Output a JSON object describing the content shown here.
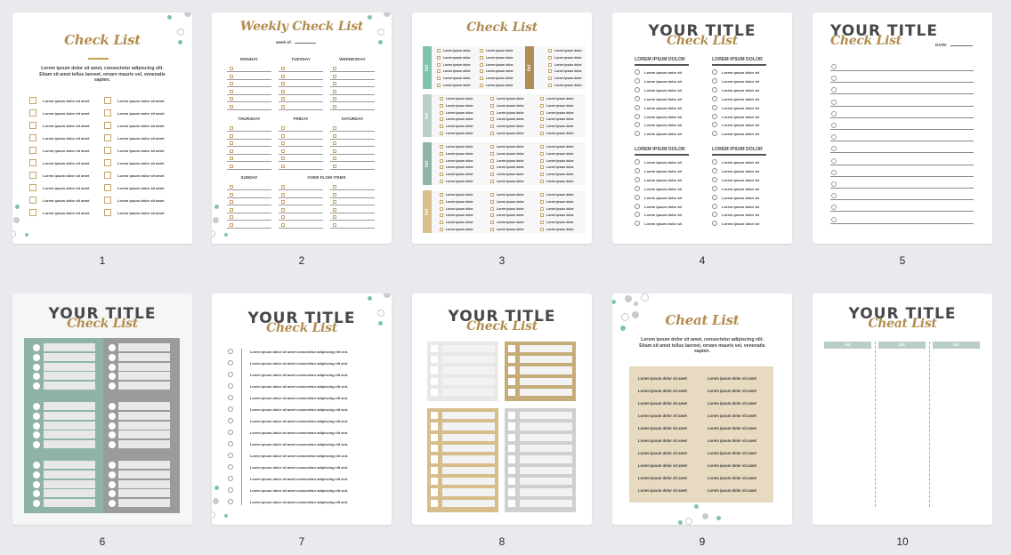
{
  "colors": {
    "background": "#e9eaee",
    "gold": "#b28d4f",
    "teal": "#7fc4ae",
    "sage": "#8fb3a7",
    "grey": "#9b9b9b",
    "tan": "#e8dac0",
    "charcoal": "#454749"
  },
  "pages": [
    {
      "number": "1",
      "title": "Check List",
      "intro": "Lorem ipsum dolor sit amet, consectetur adipiscing elit. Etiam sit amet tellus laoreet, ornare mauris vel, venenatis sapien.",
      "item": "Lorem ipsum dolor sit amet",
      "rows": 10,
      "columns": 2
    },
    {
      "number": "2",
      "title": "Weekly Check List",
      "week_label": "week of:",
      "days": [
        "MONDAY",
        "TUESDAY",
        "WEDNESDAY",
        "THURSDAY",
        "FRIDAY",
        "SATURDAY",
        "SUNDAY",
        "OVER FLOW ITEMS"
      ]
    },
    {
      "number": "3",
      "title": "Check List",
      "tab_label": "list",
      "item": "Lorem ipsum dolor"
    },
    {
      "number": "4",
      "title": "YOUR TITLE",
      "subtitle": "Check List",
      "section_heading": "LOREM IPSUM DOLOR",
      "item": "Lorem ipsum dolor sit"
    },
    {
      "number": "5",
      "title": "YOUR TITLE",
      "subtitle": "Check List",
      "date_label": "DATE:"
    },
    {
      "number": "6",
      "title": "YOUR TITLE",
      "subtitle": "Check List"
    },
    {
      "number": "7",
      "title": "YOUR TITLE",
      "subtitle": "Check List",
      "item": "Lorem ipsum dolor sit amet consectetur adipiscing elit sed."
    },
    {
      "number": "8",
      "title": "YOUR TITLE",
      "subtitle": "Check List"
    },
    {
      "number": "9",
      "title": "Cheat List",
      "intro": "Lorem ipsum dolor sit amet, consectetur adipiscing elit. Etiam sit amet tellus laoreet, ornare mauris vel, venenatis sapien.",
      "item": "Lorem ipsum dolor sit amet"
    },
    {
      "number": "10",
      "title": "YOUR TITLE",
      "subtitle": "Cheat List",
      "column_label": "list"
    }
  ]
}
